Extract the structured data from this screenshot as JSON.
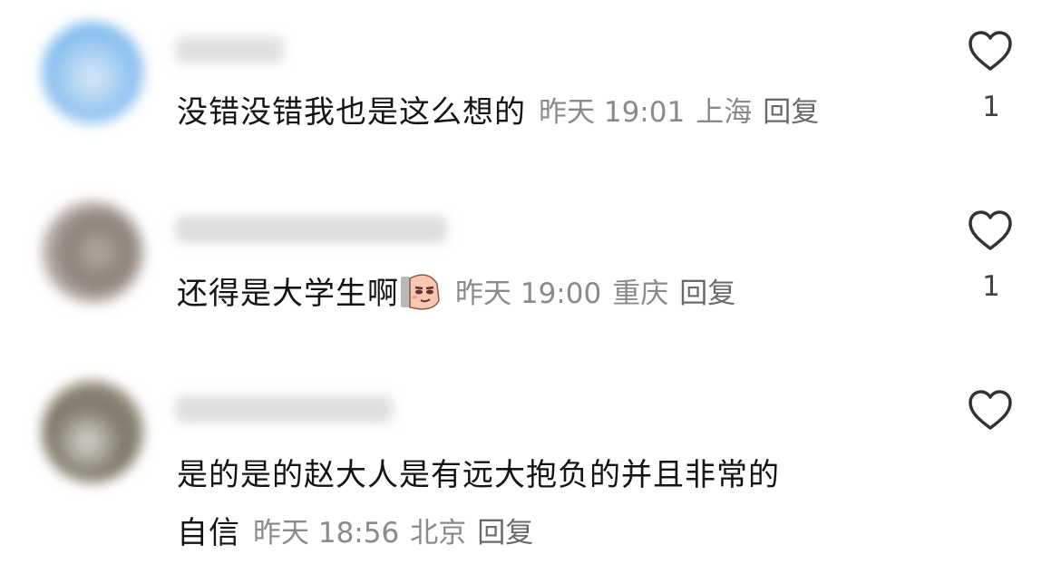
{
  "comments": [
    {
      "content": "没错没错我也是这么想的",
      "time": "昨天 19:01",
      "location": "上海",
      "reply": "回复",
      "likes": "1"
    },
    {
      "content": "还得是大学生啊",
      "time": "昨天 19:00",
      "location": "重庆",
      "reply": "回复",
      "likes": "1"
    },
    {
      "content_line1": "是的是的赵大人是有远大抱负的并且非常的",
      "content_line2": "自信",
      "time": "昨天 18:56",
      "location": "北京",
      "reply": "回复",
      "likes": ""
    }
  ],
  "icons": {
    "like": "heart-outline-icon",
    "emoji": "sly-face-sticker"
  },
  "colors": {
    "text": "#141414",
    "meta": "#8a8a8a",
    "icon": "#333333"
  }
}
